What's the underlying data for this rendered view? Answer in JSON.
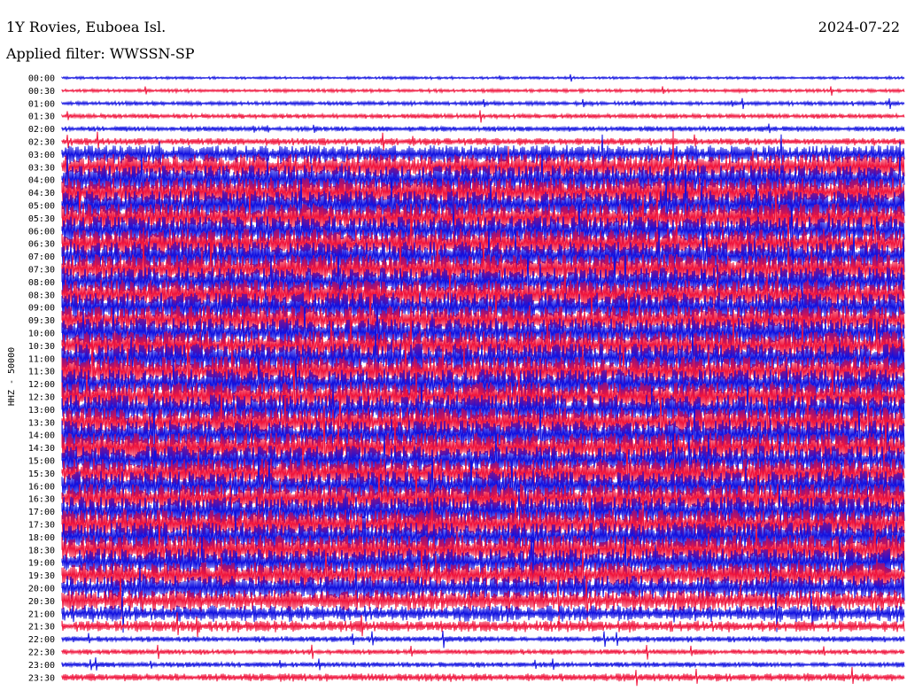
{
  "header": {
    "station": "1Y Rovies, Euboea Isl.",
    "filter": "Applied filter: WWSSN-SP",
    "date": "2024-07-22"
  },
  "colors": {
    "odd": "#1010e0",
    "even": "#f0143c",
    "background": "#ffffff"
  },
  "chart_data": {
    "type": "line",
    "title": "1Y Rovies, Euboea Isl.",
    "subtitle": "Applied filter: WWSSN-SP",
    "date": "2024-07-22",
    "ylabel": "HHZ - 50000",
    "xlabel": "",
    "row_interval_minutes": 30,
    "rows": [
      "00:00",
      "00:30",
      "01:00",
      "01:30",
      "02:00",
      "02:30",
      "03:00",
      "03:30",
      "04:00",
      "04:30",
      "05:00",
      "05:30",
      "06:00",
      "06:30",
      "07:00",
      "07:30",
      "08:00",
      "08:30",
      "09:00",
      "09:30",
      "10:00",
      "10:30",
      "11:00",
      "11:30",
      "12:00",
      "12:30",
      "13:00",
      "13:30",
      "14:00",
      "14:30",
      "15:00",
      "15:30",
      "16:00",
      "16:30",
      "17:00",
      "17:30",
      "18:00",
      "18:30",
      "19:00",
      "19:30",
      "20:00",
      "20:30",
      "21:00",
      "21:30",
      "22:00",
      "22:30",
      "23:00",
      "23:30"
    ],
    "noise_level": [
      0.08,
      0.1,
      0.12,
      0.14,
      0.16,
      0.22,
      0.55,
      0.8,
      0.9,
      0.9,
      0.9,
      0.9,
      0.9,
      0.9,
      0.9,
      0.9,
      0.9,
      0.9,
      0.9,
      0.9,
      0.9,
      0.9,
      0.9,
      0.9,
      0.9,
      0.9,
      0.9,
      0.9,
      0.9,
      0.9,
      0.9,
      0.9,
      0.9,
      0.9,
      0.9,
      0.9,
      0.9,
      0.9,
      0.85,
      0.8,
      0.75,
      0.65,
      0.5,
      0.35,
      0.18,
      0.16,
      0.16,
      0.24
    ],
    "grid": false,
    "legend": "none"
  }
}
